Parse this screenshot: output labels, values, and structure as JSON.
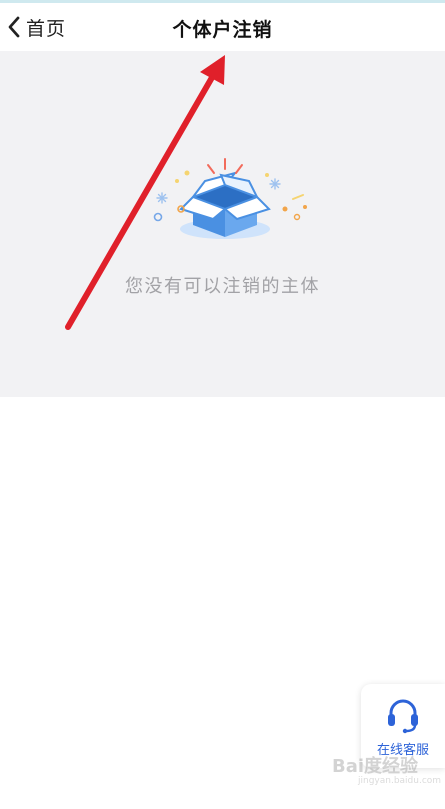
{
  "header": {
    "back_label": "首页",
    "title": "个体户注销"
  },
  "empty_state": {
    "message": "您没有可以注销的主体",
    "illustration_icon": "open-box-icon"
  },
  "customer_service": {
    "label": "在线客服",
    "icon": "headset-icon"
  },
  "watermark": {
    "brand": "Bai度经验",
    "url": "jingyan.baidu.com"
  },
  "colors": {
    "panel_background": "#f2f2f4",
    "accent_blue": "#2d63d8",
    "arrow_red": "#e0202a"
  }
}
